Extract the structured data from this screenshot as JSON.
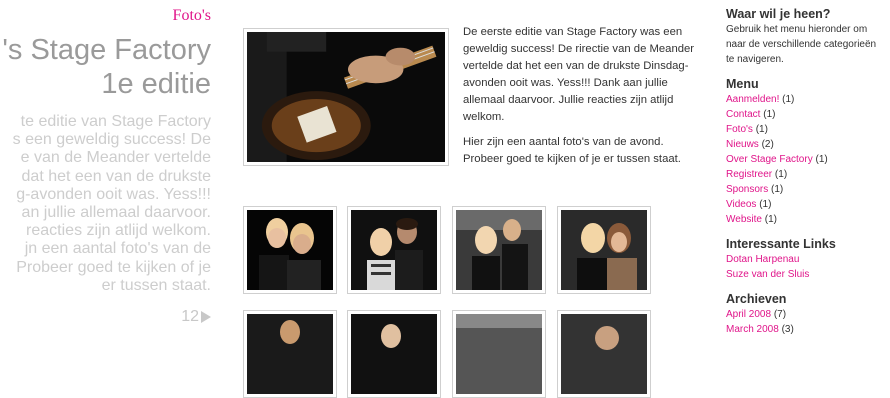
{
  "post": {
    "category": "Foto's",
    "title_line1": "'s Stage Factory",
    "title_line2": "1e editie",
    "excerpt_lines": [
      "te editie van Stage Factory",
      "s een geweldig success! De",
      "e van de Meander vertelde",
      "dat het een van de drukste",
      "g-avonden ooit was. Yess!!!",
      "an jullie allemaal daarvoor.",
      "reacties zijn atlijd welkom.",
      "jn een aantal foto's van de",
      "Probeer goed te kijken of je",
      "er tussen staat."
    ],
    "comment_count": "12",
    "body_paragraph1": "De eerste editie van Stage Factory was een geweldig success! De rirectie van de Meander vertelde dat het een van de drukste Dinsdag-avonden ooit was. Yess!!! Dank aan jullie allemaal daarvoor. Jullie reacties zijn atlijd welkom.",
    "body_paragraph2": "Hier zijn een aantal foto's van de avond. Probeer goed te kijken of je er tussen staat."
  },
  "sidebar": {
    "where_heading": "Waar wil je heen?",
    "where_text": "Gebruik het menu hieronder om naar de verschillende categorieën te navigeren.",
    "menu_heading": "Menu",
    "menu_items": [
      {
        "label": "Aanmelden!",
        "count": "(1)"
      },
      {
        "label": "Contact",
        "count": "(1)"
      },
      {
        "label": "Foto's",
        "count": "(1)"
      },
      {
        "label": "Nieuws",
        "count": "(2)"
      },
      {
        "label": "Over Stage Factory",
        "count": "(1)"
      },
      {
        "label": "Registreer",
        "count": "(1)"
      },
      {
        "label": "Sponsors",
        "count": "(1)"
      },
      {
        "label": "Videos",
        "count": "(1)"
      },
      {
        "label": "Website",
        "count": "(1)"
      }
    ],
    "links_heading": "Interessante Links",
    "links": [
      {
        "label": "Dotan Harpenau"
      },
      {
        "label": "Suze van der Sluis"
      }
    ],
    "archive_heading": "Archieven",
    "archives": [
      {
        "label": "April 2008",
        "count": "(7)"
      },
      {
        "label": "March 2008",
        "count": "(3)"
      }
    ]
  },
  "colors": {
    "link": "#e0158a",
    "title_grey": "#9a9a9a",
    "excerpt_grey": "#cdcdcd"
  }
}
